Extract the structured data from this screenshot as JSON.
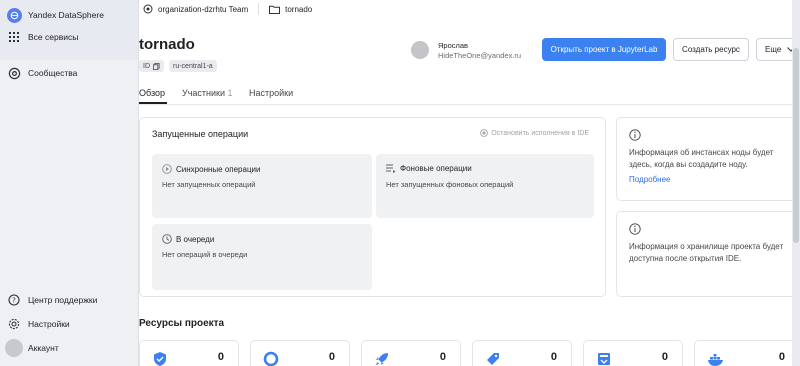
{
  "sidebar": {
    "brand": "Yandex DataSphere",
    "items": [
      {
        "label": "Все сервисы"
      },
      {
        "label": "Сообщества"
      }
    ],
    "bottom": [
      {
        "label": "Центр поддержки"
      },
      {
        "label": "Настройки"
      },
      {
        "label": "Аккаунт"
      }
    ]
  },
  "breadcrumb": {
    "org": "organization-dzrhtu Team",
    "project": "tornado"
  },
  "project": {
    "title": "tornado",
    "id_label": "ID",
    "zone": "ru-central1-a"
  },
  "user": {
    "name": "Ярослав",
    "email": "HideTheOne@yandex.ru"
  },
  "actions": {
    "open_jupyter": "Открыть проект в JupyterLab",
    "create_resource": "Создать ресурс",
    "more": "Еще"
  },
  "tabs": [
    {
      "label": "Обзор"
    },
    {
      "label": "Участники",
      "count": "1"
    },
    {
      "label": "Настройки"
    }
  ],
  "operations": {
    "title": "Запущенные операции",
    "stop_label": "Остановить исполнения в IDE",
    "cards": [
      {
        "title": "Синхронные операции",
        "desc": "Нет запущенных операций"
      },
      {
        "title": "Фоновые операции",
        "desc": "Нет запущенных фоновых операций"
      },
      {
        "title": "В очереди",
        "desc": "Нет операций в очереди"
      }
    ]
  },
  "info": {
    "nodes_text": "Информация об инстансах ноды будет здесь, когда вы создадите ноду.",
    "nodes_link": "Подробнее",
    "storage_text": "Информация о хранилище проекта будет доступна после открытия IDE."
  },
  "resources": {
    "title": "Ресурсы проекта",
    "counts": [
      "0",
      "0",
      "0",
      "0",
      "0",
      "0"
    ]
  },
  "colors": {
    "primary": "#3b81ef",
    "link": "#2f6fe0"
  }
}
